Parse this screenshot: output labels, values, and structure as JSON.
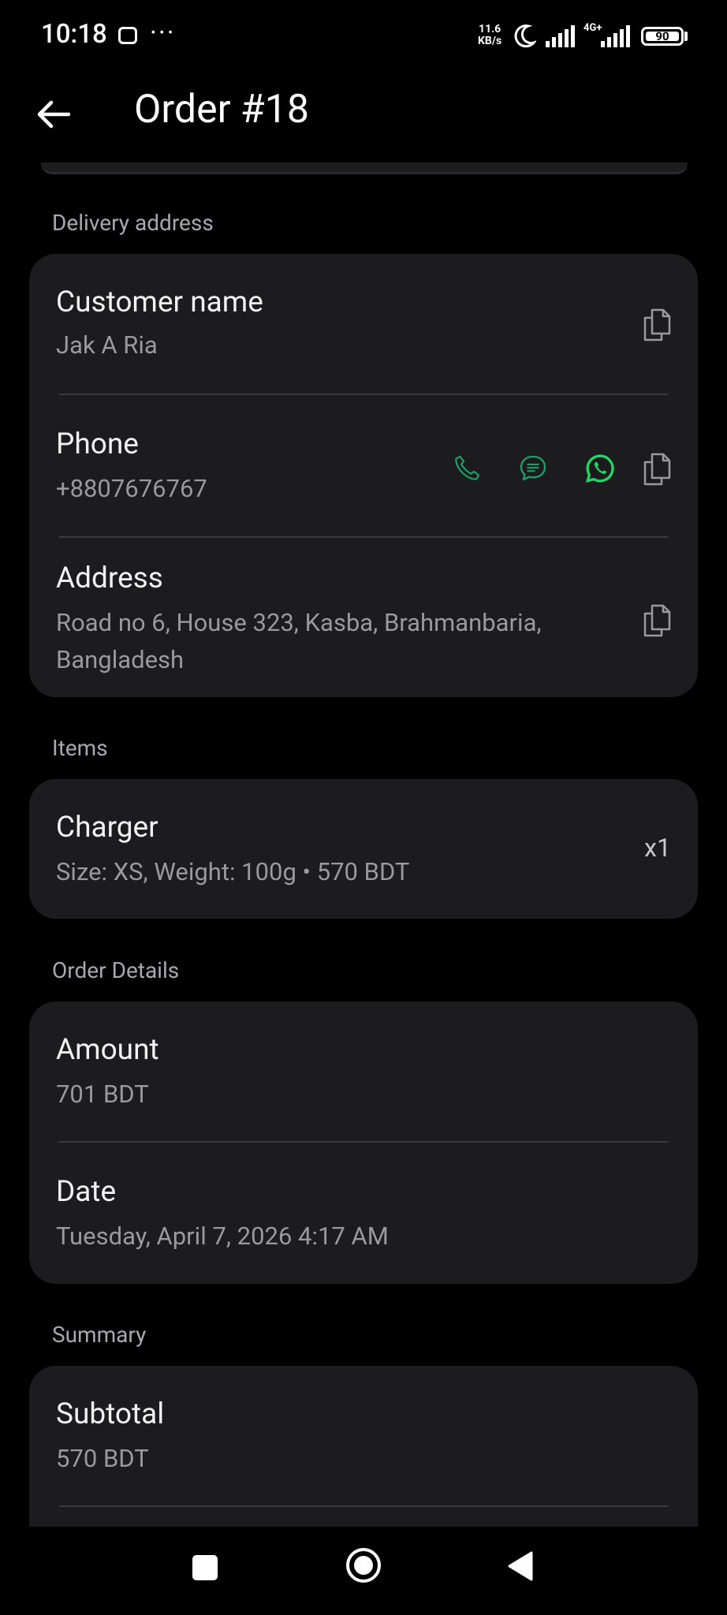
{
  "status_bar": {
    "time": "10:18",
    "speed_value": "11.6",
    "speed_unit": "KB/s",
    "network": "4G+",
    "battery": "90"
  },
  "app_bar": {
    "title": "Order #18",
    "back_icon": "arrow-left-icon"
  },
  "delivery": {
    "section_label": "Delivery address",
    "customer_label": "Customer name",
    "customer_value": "Jak A Ria",
    "phone_label": "Phone",
    "phone_value": "+8807676767",
    "address_label": "Address",
    "address_value": "Road no 6, House 323, Kasba, Brahmanbaria, Bangladesh"
  },
  "items": {
    "section_label": "Items",
    "list": [
      {
        "name": "Charger",
        "details": "Size: XS, Weight: 100g • 570 BDT",
        "qty": "x1"
      }
    ]
  },
  "order_details": {
    "section_label": "Order Details",
    "amount_label": "Amount",
    "amount_value": "701 BDT",
    "date_label": "Date",
    "date_value": "Tuesday, April 7, 2026 4:17 AM"
  },
  "summary": {
    "section_label": "Summary",
    "subtotal_label": "Subtotal",
    "subtotal_value": "570 BDT"
  },
  "colors": {
    "background": "#000000",
    "card": "#1c1c1e",
    "accent_green": "#25d366",
    "muted_green": "#1f9e6a",
    "secondary_text": "#9a9a9e"
  }
}
